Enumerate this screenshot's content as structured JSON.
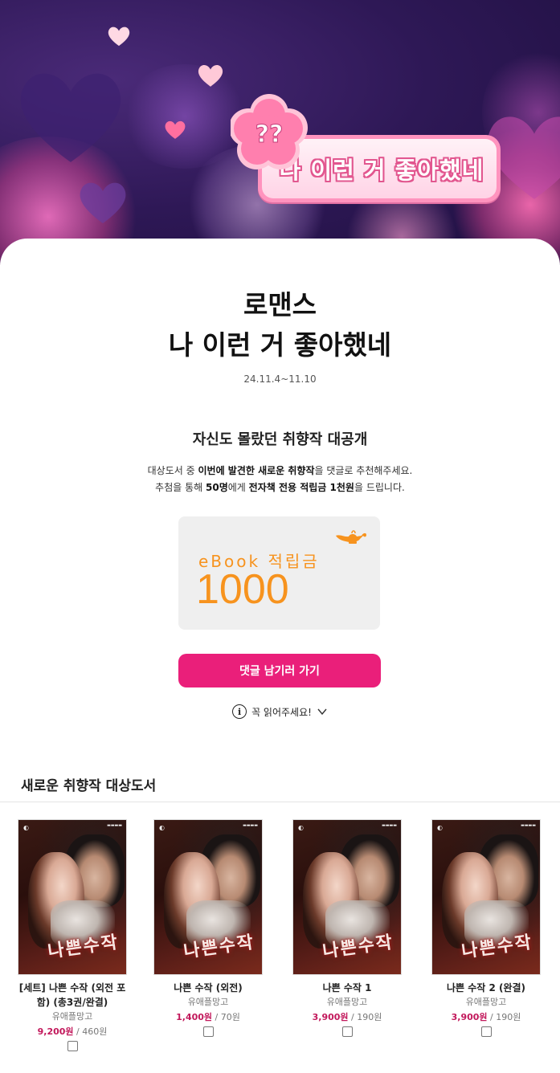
{
  "banner": {
    "badge_question": "??",
    "badge_text": "나 이런 거 좋아했네"
  },
  "event": {
    "title_line1": "로맨스",
    "title_line2": "나 이런 거 좋아했네",
    "date": "24.11.4~11.10",
    "subtitle": "자신도 몰랐던 취향작 대공개",
    "desc1_a": "대상도서 중 ",
    "desc1_b": "이번에 발견한 새로운 취향작",
    "desc1_c": "을 댓글로 추천해주세요.",
    "desc2_a": "추첨을 통해 ",
    "desc2_b": "50명",
    "desc2_c": "에게 ",
    "desc2_d": "전자책 전용 적립금 1천원",
    "desc2_e": "을 드립니다."
  },
  "coupon": {
    "label": "eBook 적립금",
    "value": "1000",
    "color": "#f7931e"
  },
  "cta": {
    "label": "댓글 남기러 가기",
    "color": "#ea1f7a"
  },
  "notice": {
    "icon_text": "i",
    "label": "꼭 읽어주세요!"
  },
  "section": {
    "title": "새로운 취향작 대상도서"
  },
  "books": [
    {
      "title_line1": "[세트] 나쁜 수작 (외전 포",
      "title_line2": "함) (총3권/완결)",
      "publisher": "유애플망고",
      "price": "9,200원",
      "point": " / 460원",
      "cover_title": "나쁜수작"
    },
    {
      "title_line1": "나쁜 수작 (외전)",
      "title_line2": "",
      "publisher": "유애플망고",
      "price": "1,400원",
      "point": " / 70원",
      "cover_title": "나쁜수작"
    },
    {
      "title_line1": "나쁜 수작 1",
      "title_line2": "",
      "publisher": "유애플망고",
      "price": "3,900원",
      "point": " / 190원",
      "cover_title": "나쁜수작"
    },
    {
      "title_line1": "나쁜 수작 2 (완결)",
      "title_line2": "",
      "publisher": "유애플망고",
      "price": "3,900원",
      "point": " / 190원",
      "cover_title": "나쁜수작"
    }
  ]
}
